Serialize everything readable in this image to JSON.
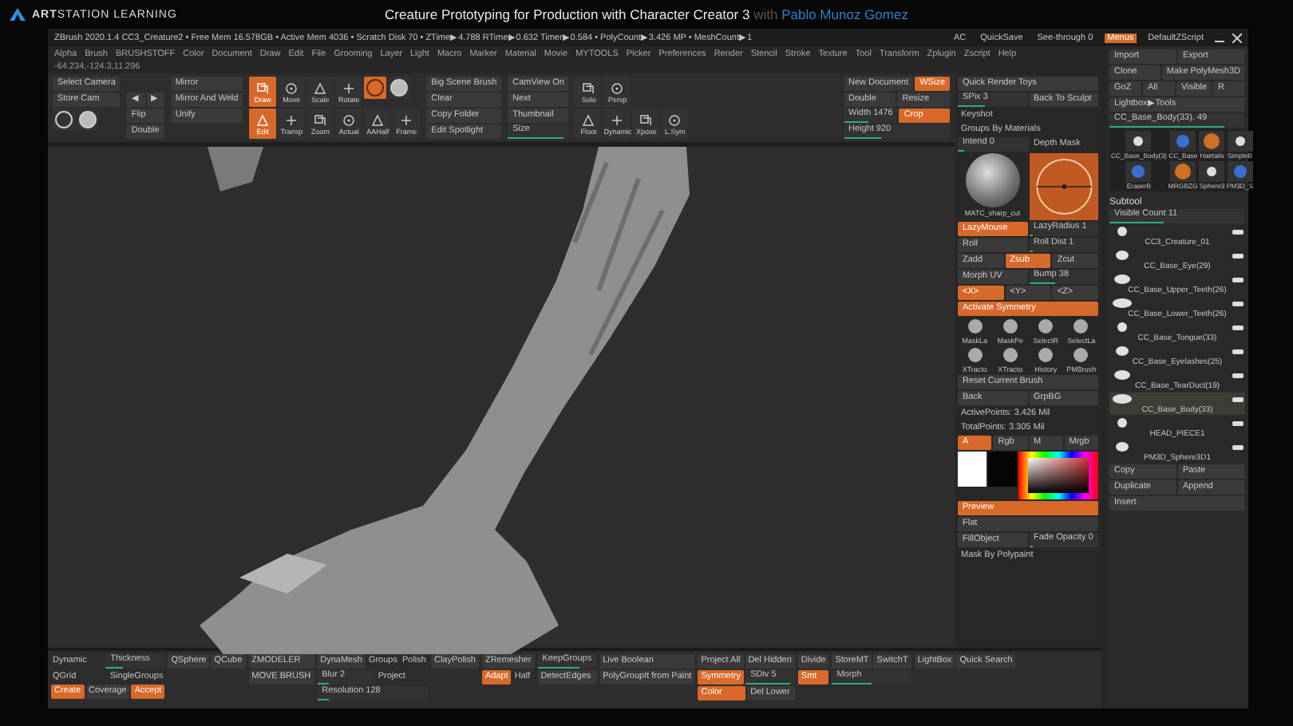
{
  "header": {
    "brand": "**ART**STATION LEARNING",
    "title": "Creature Prototyping for Production with Character Creator 3",
    "by": "with",
    "author": "Pablo Munoz Gomez"
  },
  "titlebar": {
    "status": "ZBrush 2020.1.4   CC3_Creature2  • Free Mem 16.578GB • Active Mem 4036 • Scratch Disk 70 • ZTime▶4.788 RTime▶0.632 Timer▶0.584 • PolyCount▶3.426 MP • MeshCount▶1",
    "items": [
      {
        "label": "AC",
        "on": false
      },
      {
        "label": "QuickSave",
        "on": false
      },
      {
        "label": "See-through 0",
        "on": false
      },
      {
        "label": "Menus",
        "on": true
      },
      {
        "label": "DefaultZScript",
        "on": false
      }
    ]
  },
  "menu": [
    "Alpha",
    "Brush",
    "BRUSHSTOFF",
    "Color",
    "Document",
    "Draw",
    "Edit",
    "File",
    "Grooming",
    "Layer",
    "Light",
    "Macro",
    "Marker",
    "Material",
    "Movie",
    "MYTOOLS",
    "Picker",
    "Preferences",
    "Render",
    "Stencil",
    "Stroke",
    "Texture",
    "Tool",
    "Transform",
    "Zplugin",
    "Zscript",
    "Help"
  ],
  "coords": "-64.234,-124.3,11.296",
  "toolbar": [
    {
      "rows": [
        [
          {
            "kind": "button",
            "label": "Select Camera",
            "on": false
          }
        ],
        [
          {
            "kind": "button",
            "label": "Store Cam",
            "on": false
          }
        ],
        [
          {
            "kind": "icon",
            "on": false
          },
          {
            "kind": "icon",
            "on": false
          }
        ]
      ]
    },
    {
      "rows": [
        [
          {
            "kind": "button",
            "label": "◀",
            "on": false
          },
          {
            "kind": "button",
            "label": "▶",
            "on": false
          }
        ],
        [
          {
            "kind": "button",
            "label": "Flip",
            "on": false
          }
        ],
        [
          {
            "kind": "button",
            "label": "Double",
            "on": false
          }
        ]
      ]
    },
    {
      "rows": [
        [
          {
            "kind": "button",
            "label": "Mirror",
            "on": false
          }
        ],
        [
          {
            "kind": "button",
            "label": "Mirror And Weld",
            "on": false
          }
        ],
        [
          {
            "kind": "button",
            "label": "Unify",
            "on": false
          }
        ]
      ]
    },
    {
      "rows": [
        [
          {
            "kind": "tool",
            "label": "Draw",
            "on": true
          },
          {
            "kind": "tool",
            "label": "Move",
            "on": false
          },
          {
            "kind": "tool",
            "label": "Scale",
            "on": false
          },
          {
            "kind": "tool",
            "label": "Rotate",
            "on": false
          },
          {
            "kind": "icon",
            "on": true
          },
          {
            "kind": "icon",
            "on": false
          }
        ],
        [
          {
            "kind": "tool",
            "label": "Edit",
            "on": true
          },
          {
            "kind": "tool",
            "label": "Transp",
            "on": false
          },
          {
            "kind": "tool",
            "label": "Zoom",
            "on": false
          },
          {
            "kind": "tool",
            "label": "Actual",
            "on": false
          },
          {
            "kind": "tool",
            "label": "AAHalf",
            "on": false
          },
          {
            "kind": "tool",
            "label": "Frame",
            "on": false
          }
        ]
      ]
    },
    {
      "rows": [
        [
          {
            "kind": "button",
            "label": "Big Scene Brush",
            "on": false
          }
        ],
        [
          {
            "kind": "button",
            "label": "Clear",
            "on": false
          }
        ],
        [
          {
            "kind": "button",
            "label": "Copy Folder",
            "on": false
          }
        ],
        [
          {
            "kind": "button",
            "label": "Edit Spotlight",
            "on": false
          }
        ]
      ]
    },
    {
      "rows": [
        [
          {
            "kind": "button",
            "label": "CamView On",
            "on": false
          }
        ],
        [
          {
            "kind": "button",
            "label": "Next",
            "on": false
          }
        ],
        [
          {
            "kind": "button",
            "label": "Thumbnail",
            "on": false
          }
        ],
        [
          {
            "kind": "slider",
            "label": "Size",
            "level": 0.9
          }
        ]
      ]
    },
    {
      "rows": [
        [
          {
            "kind": "tool",
            "label": "Solo",
            "on": false
          },
          {
            "kind": "tool",
            "label": "Persp",
            "on": false
          }
        ],
        [
          {
            "kind": "tool",
            "label": "Floor",
            "on": false
          },
          {
            "kind": "tool",
            "label": "Dynamic",
            "on": false
          },
          {
            "kind": "tool",
            "label": "Xpose",
            "on": false
          },
          {
            "kind": "tool",
            "label": "L.Sym",
            "on": false
          }
        ]
      ]
    },
    {
      "rows": [
        [
          {
            "kind": "button",
            "label": "New Document",
            "on": false
          },
          {
            "kind": "button",
            "label": "WSize",
            "on": true
          }
        ],
        [
          {
            "kind": "button",
            "label": "Double",
            "on": false
          },
          {
            "kind": "button",
            "label": "Resize",
            "on": false
          }
        ],
        [
          {
            "kind": "slider",
            "label": "Width 1476",
            "level": 0.45
          },
          {
            "kind": "button",
            "label": "Crop",
            "on": true
          }
        ],
        [
          {
            "kind": "slider",
            "label": "Height 920",
            "level": 0.35
          }
        ]
      ]
    }
  ],
  "palette": [
    [
      {
        "kind": "button",
        "label": "Quick Render Toys",
        "on": false
      }
    ],
    [
      {
        "kind": "slider",
        "label": "SPix 3",
        "level": 0.4
      },
      {
        "kind": "button",
        "label": "Back To Sculpt",
        "on": false
      }
    ],
    [
      {
        "kind": "text",
        "label": "Keyshot"
      }
    ],
    [
      {
        "kind": "text",
        "label": "Groups By Materials"
      }
    ],
    [
      {
        "kind": "slider",
        "label": "Intend 0",
        "level": 0.1
      },
      {
        "kind": "text",
        "label": "Depth Mask"
      }
    ],
    [
      {
        "kind": "material",
        "label": "MATC_sharp_cut"
      },
      {
        "kind": "depth_mask"
      }
    ],
    [
      {
        "kind": "button",
        "label": "LazyMouse",
        "on": true
      },
      {
        "kind": "slider",
        "label": "LazyRadius 1",
        "level": 0.05
      }
    ],
    [
      {
        "kind": "button",
        "label": "Roll",
        "on": false
      },
      {
        "kind": "slider",
        "label": "Roll Dist 1",
        "level": 0.05
      }
    ],
    [
      {
        "kind": "button",
        "label": "Zadd",
        "on": false
      },
      {
        "kind": "button",
        "label": "Zsub",
        "on": true
      },
      {
        "kind": "button",
        "label": "Zcut",
        "on": false
      }
    ],
    [
      {
        "kind": "button",
        "label": "Morph UV",
        "on": false
      },
      {
        "kind": "slider",
        "label": "Bump 38",
        "level": 0.38
      }
    ],
    [
      {
        "kind": "button",
        "label": "<X>",
        "on": true
      },
      {
        "kind": "button",
        "label": "<Y>",
        "on": false
      },
      {
        "kind": "button",
        "label": "<Z>",
        "on": false
      }
    ],
    [
      {
        "kind": "button",
        "label": "Activate Symmetry",
        "on": true
      }
    ],
    [
      {
        "kind": "thumb",
        "label": "MaskLa"
      },
      {
        "kind": "thumb",
        "label": "MaskPe"
      },
      {
        "kind": "thumb",
        "label": "SelectR"
      },
      {
        "kind": "thumb",
        "label": "SelectLa"
      }
    ],
    [
      {
        "kind": "thumb",
        "label": "XTracto"
      },
      {
        "kind": "thumb",
        "label": "XTracto"
      },
      {
        "kind": "thumb",
        "label": "History"
      },
      {
        "kind": "thumb",
        "label": "PMBrush"
      }
    ],
    [
      {
        "kind": "button",
        "label": "Reset Current Brush",
        "on": false
      }
    ],
    [
      {
        "kind": "button",
        "label": "Back",
        "on": false
      },
      {
        "kind": "button",
        "label": "GrpBG",
        "on": false
      }
    ],
    [
      {
        "kind": "text",
        "label": "ActivePoints: 3.426 Mil"
      }
    ],
    [
      {
        "kind": "text",
        "label": "TotalPoints: 3.305 Mil"
      }
    ],
    [
      {
        "kind": "button",
        "label": "A",
        "on": true
      },
      {
        "kind": "button",
        "label": "Rgb",
        "on": false
      },
      {
        "kind": "button",
        "label": "M",
        "on": false
      },
      {
        "kind": "button",
        "label": "Mrgb",
        "on": false
      }
    ],
    [
      {
        "kind": "swatch",
        "color": "#ffffff"
      },
      {
        "kind": "swatch",
        "color": "#050505"
      },
      {
        "kind": "picker"
      }
    ],
    [
      {
        "kind": "button",
        "label": "Preview",
        "on": true
      }
    ],
    [
      {
        "kind": "button",
        "label": "Flat",
        "on": false
      }
    ],
    [
      {
        "kind": "button",
        "label": "FillObject",
        "on": false
      },
      {
        "kind": "slider",
        "label": "Fade Opacity 0",
        "level": 0.05
      }
    ],
    [
      {
        "kind": "text",
        "label": "Mask By Polypaint"
      }
    ]
  ],
  "side": {
    "rows": [
      [
        {
          "kind": "button",
          "label": "Import",
          "on": false
        },
        {
          "kind": "button",
          "label": "Export",
          "on": false
        }
      ],
      [
        {
          "kind": "button",
          "label": "Clone",
          "on": false
        },
        {
          "kind": "button",
          "label": "Make PolyMesh3D",
          "on": false
        }
      ],
      [
        {
          "kind": "button",
          "label": "GoZ",
          "on": false
        },
        {
          "kind": "button",
          "label": "All",
          "on": false
        },
        {
          "kind": "button",
          "label": "Visible",
          "on": false
        },
        {
          "kind": "button",
          "label": "R",
          "on": false
        }
      ],
      [
        {
          "kind": "button",
          "label": "Lightbox▶Tools",
          "on": false
        }
      ],
      [
        {
          "kind": "slider",
          "label": "CC_Base_Body(33). 49",
          "level": 0.85
        }
      ]
    ],
    "tools": [
      {
        "label": "CC_Base_Body(3)"
      },
      {
        "label": "CC_Base"
      },
      {
        "label": "Hairtails"
      },
      {
        "label": "SimpleB"
      },
      {
        "label": "EraserB"
      },
      {
        "label": "MRGBZG"
      },
      {
        "label": "Sphere3"
      },
      {
        "label": "PM3D_S"
      }
    ],
    "subtool_title": "Subtool",
    "visible_count": {
      "label": "Visible Count 11",
      "level": 0.4
    },
    "subtools": [
      {
        "name": "CC3_Creature_01",
        "selected": false
      },
      {
        "name": "CC_Base_Eye(29)",
        "selected": false
      },
      {
        "name": "CC_Base_Upper_Teeth(26)",
        "selected": false
      },
      {
        "name": "CC_Base_Lower_Teeth(26)",
        "selected": false
      },
      {
        "name": "CC_Base_Tongue(33)",
        "selected": false
      },
      {
        "name": "CC_Base_Eyelashes(25)",
        "selected": false
      },
      {
        "name": "CC_Base_TearDuct(19)",
        "selected": false
      },
      {
        "name": "CC_Base_Body(33)",
        "selected": true
      },
      {
        "name": "HEAD_PIECE1",
        "selected": false
      },
      {
        "name": "PM3D_Sphere3D1",
        "selected": false
      }
    ],
    "bottom": [
      [
        {
          "kind": "button",
          "label": "Copy",
          "on": false
        },
        {
          "kind": "button",
          "label": "Paste",
          "on": false
        }
      ],
      [
        {
          "kind": "button",
          "label": "Duplicate",
          "on": false
        },
        {
          "kind": "button",
          "label": "Append",
          "on": false
        }
      ],
      [
        {
          "kind": "button",
          "label": "Insert",
          "on": false
        }
      ]
    ]
  },
  "shelf": [
    {
      "rows": [
        [
          {
            "kind": "text",
            "label": "Dynamic"
          },
          {
            "kind": "slider",
            "label": "Thickness",
            "level": 0.3
          }
        ],
        [
          {
            "kind": "text",
            "label": "QGrid"
          },
          {
            "kind": "text",
            "label": "SingleGroups"
          }
        ],
        [
          {
            "kind": "button",
            "label": "Create",
            "on": true
          },
          {
            "kind": "button",
            "label": "Coverage",
            "on": false
          },
          {
            "kind": "button",
            "label": "Accept",
            "on": true
          }
        ]
      ]
    },
    {
      "rows": [
        [
          {
            "kind": "button",
            "label": "QSphere",
            "on": false
          },
          {
            "kind": "button",
            "label": "QCube",
            "on": false
          }
        ]
      ]
    },
    {
      "rows": [
        [
          {
            "kind": "button",
            "label": "ZMODELER",
            "on": false
          }
        ],
        [
          {
            "kind": "button",
            "label": "MOVE BRUSH",
            "on": false
          }
        ]
      ]
    },
    {
      "rows": [
        [
          {
            "kind": "button",
            "label": "DynaMesh",
            "on": false
          },
          {
            "kind": "text",
            "label": "Groups"
          },
          {
            "kind": "text",
            "label": "Polish"
          }
        ],
        [
          {
            "kind": "slider",
            "label": "Blur 2",
            "level": 0.2
          },
          {
            "kind": "text",
            "label": "Project"
          }
        ],
        [
          {
            "kind": "slider",
            "label": "Resolution 128",
            "level": 0.1
          }
        ]
      ]
    },
    {
      "rows": [
        [
          {
            "kind": "button",
            "label": "ClayPolish",
            "on": false
          }
        ]
      ]
    },
    {
      "rows": [
        [
          {
            "kind": "button",
            "label": "ZRemesher",
            "on": false
          }
        ],
        [
          {
            "kind": "button",
            "label": "Adapt",
            "on": true
          },
          {
            "kind": "text",
            "label": "Half"
          }
        ]
      ]
    },
    {
      "rows": [
        [
          {
            "kind": "slider",
            "label": "KeepGroups",
            "level": 0.7
          }
        ],
        [
          {
            "kind": "button",
            "label": "DetectEdges",
            "on": false
          }
        ]
      ]
    },
    {
      "rows": [
        [
          {
            "kind": "button",
            "label": "Live Boolean",
            "on": false
          }
        ],
        [
          {
            "kind": "button",
            "label": "PolyGroupIt from Paint",
            "on": false
          }
        ]
      ]
    },
    {
      "rows": [
        [
          {
            "kind": "button",
            "label": "Project All",
            "on": false
          },
          {
            "kind": "button",
            "label": "Del Hidden",
            "on": false
          }
        ],
        [
          {
            "kind": "button",
            "label": "Symmetry",
            "on": true
          },
          {
            "kind": "slider",
            "label": "SDiv 5",
            "level": 0.9
          }
        ],
        [
          {
            "kind": "button",
            "label": "Color",
            "on": true
          },
          {
            "kind": "button",
            "label": "Del Lower",
            "on": false
          }
        ]
      ]
    },
    {
      "rows": [
        [
          {
            "kind": "button",
            "label": "Divide",
            "on": false
          }
        ],
        [
          {
            "kind": "button",
            "label": "Smt",
            "on": true
          }
        ]
      ]
    },
    {
      "rows": [
        [
          {
            "kind": "button",
            "label": "StoreMT",
            "on": false
          },
          {
            "kind": "button",
            "label": "SwitchT",
            "on": false
          }
        ],
        [
          {
            "kind": "slider",
            "label": "Morph",
            "level": 0.5
          }
        ]
      ]
    },
    {
      "rows": [
        [
          {
            "kind": "button",
            "label": "LightBox",
            "on": false
          },
          {
            "kind": "button",
            "label": "Quick Search",
            "on": false
          }
        ]
      ]
    }
  ]
}
